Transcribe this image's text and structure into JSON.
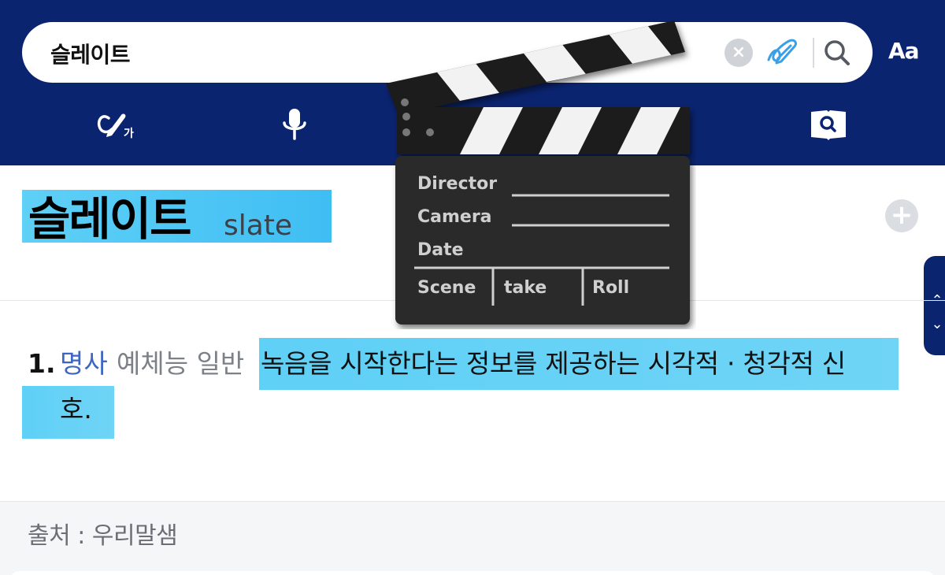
{
  "search": {
    "query": "슬레이트"
  },
  "header": {
    "font_button_label": "Aa"
  },
  "entry": {
    "word": "슬레이트",
    "original": "slate"
  },
  "definition": {
    "number": "1.",
    "part_of_speech": "명사",
    "field": "예체능 일반",
    "text_line1": "녹음을 시작한다는 정보를 제공하는 시각적 · 청각적 신",
    "text_line2": "호."
  },
  "source": {
    "label": "출처 : 우리말샘"
  },
  "clapperboard": {
    "rows": [
      "Director",
      "Camera",
      "Date"
    ],
    "cells": [
      "Scene",
      "take",
      "Roll"
    ]
  },
  "colors": {
    "header_bg": "#0b2470",
    "highlight": "#5fd0f6",
    "pos_color": "#3b66c4"
  }
}
